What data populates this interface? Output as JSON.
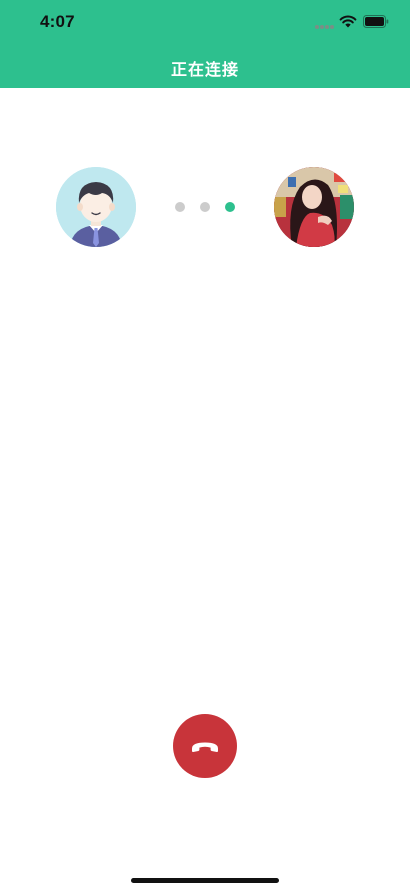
{
  "status_bar": {
    "time": "4:07",
    "icons": [
      "signal-dots-icon",
      "wifi-icon",
      "battery-icon"
    ]
  },
  "header": {
    "title": "正在连接",
    "background_color": "#2dc08e"
  },
  "call": {
    "local_avatar": "cartoon-man-avatar",
    "remote_avatar": "remote-user-photo",
    "connecting_dots": [
      {
        "state": "inactive",
        "color": "#cccccc"
      },
      {
        "state": "inactive",
        "color": "#cccccc"
      },
      {
        "state": "active",
        "color": "#2dc08e"
      }
    ]
  },
  "controls": {
    "hangup_icon": "phone-hangup-icon",
    "hangup_color": "#c8343a"
  }
}
